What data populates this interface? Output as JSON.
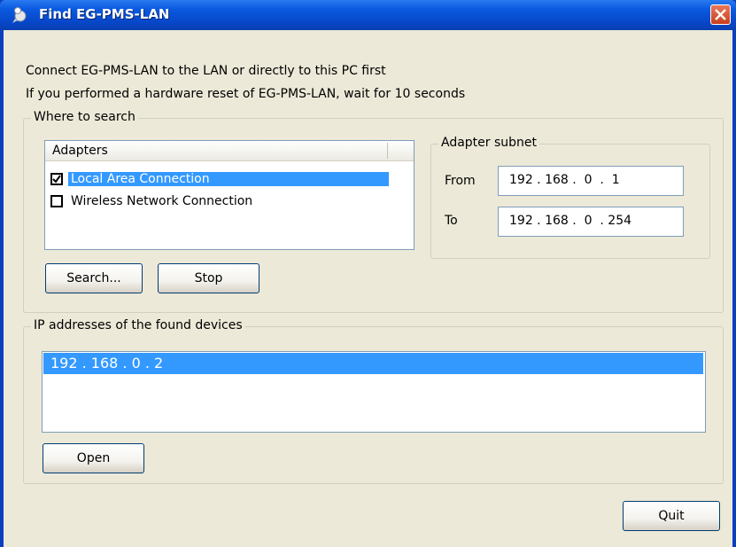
{
  "window": {
    "title": "Find EG-PMS-LAN"
  },
  "messages": {
    "line1": "Connect EG-PMS-LAN to the LAN or directly to this PC first",
    "line2": "If you performed a hardware reset of EG-PMS-LAN, wait for 10 seconds"
  },
  "where_to_search": {
    "label": "Where to search",
    "adapters_header": "Adapters",
    "adapters": [
      {
        "label": "Local Area Connection",
        "checked": true,
        "selected": true
      },
      {
        "label": "Wireless Network Connection",
        "checked": false,
        "selected": false
      }
    ],
    "subnet": {
      "label": "Adapter subnet",
      "from_label": "From",
      "from_value": "192 . 168 .  0  .  1",
      "to_label": "To",
      "to_value": "192 . 168 .  0  . 254"
    },
    "search_button": "Search...",
    "stop_button": "Stop"
  },
  "found": {
    "label": "IP addresses of the found devices",
    "items": [
      "192 . 168 . 0 . 2"
    ],
    "open_button": "Open"
  },
  "quit_button": "Quit",
  "colors": {
    "titlebar": "#0a5ae0",
    "selection": "#3399ff",
    "dialog_bg": "#ece9d8",
    "close_button": "#c9401a"
  }
}
